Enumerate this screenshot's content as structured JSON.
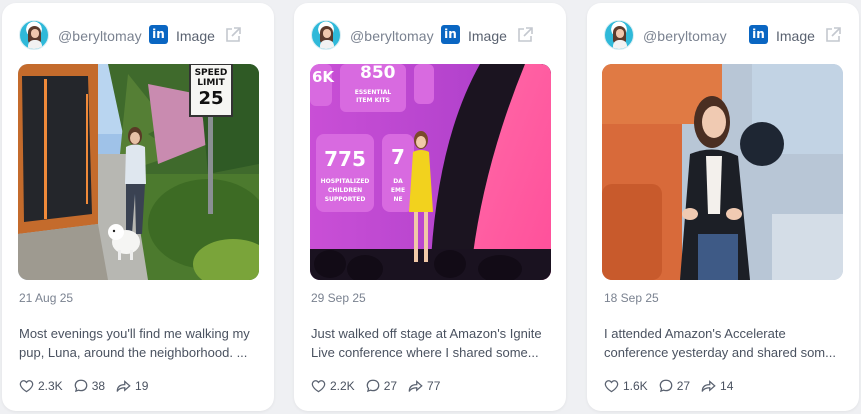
{
  "posts": [
    {
      "handle": "@beryltomay",
      "network": "in",
      "type": "Image",
      "date": "21 Aug 25",
      "caption_line1": "Most evenings you'll find me walking my",
      "caption_line2": "pup, Luna, around the neighborhood. ...",
      "likes": "2.3K",
      "comments": "38",
      "shares": "19",
      "sign_text": [
        "SPEED",
        "LIMIT",
        "25"
      ]
    },
    {
      "handle": "@beryltomay",
      "network": "in",
      "type": "Image",
      "date": "29 Sep 25",
      "caption_line1": "Just walked off stage at Amazon's Ignite",
      "caption_line2": "Live conference where I shared some...",
      "likes": "2.2K",
      "comments": "27",
      "shares": "77",
      "stage_text": [
        "6K",
        "850",
        "ESSENTIAL",
        "ITEM KITS",
        "775",
        "HOSPITALIZED",
        "CHILDREN",
        "SUPPORTED",
        "7",
        "DA",
        "EME",
        "NE"
      ]
    },
    {
      "handle": "@beryltomay",
      "network": "in",
      "type": "Image",
      "date": "18 Sep 25",
      "caption_line1": "I attended Amazon's Accelerate",
      "caption_line2": "conference yesterday and shared som...",
      "likes": "1.6K",
      "comments": "27",
      "shares": "14"
    }
  ],
  "colors": {
    "linkedin": "#0a66c2",
    "background": "#eff0f3",
    "card": "#ffffff"
  },
  "icons": [
    "linkedin-icon",
    "external-link-icon",
    "heart-icon",
    "comment-icon",
    "share-icon"
  ]
}
